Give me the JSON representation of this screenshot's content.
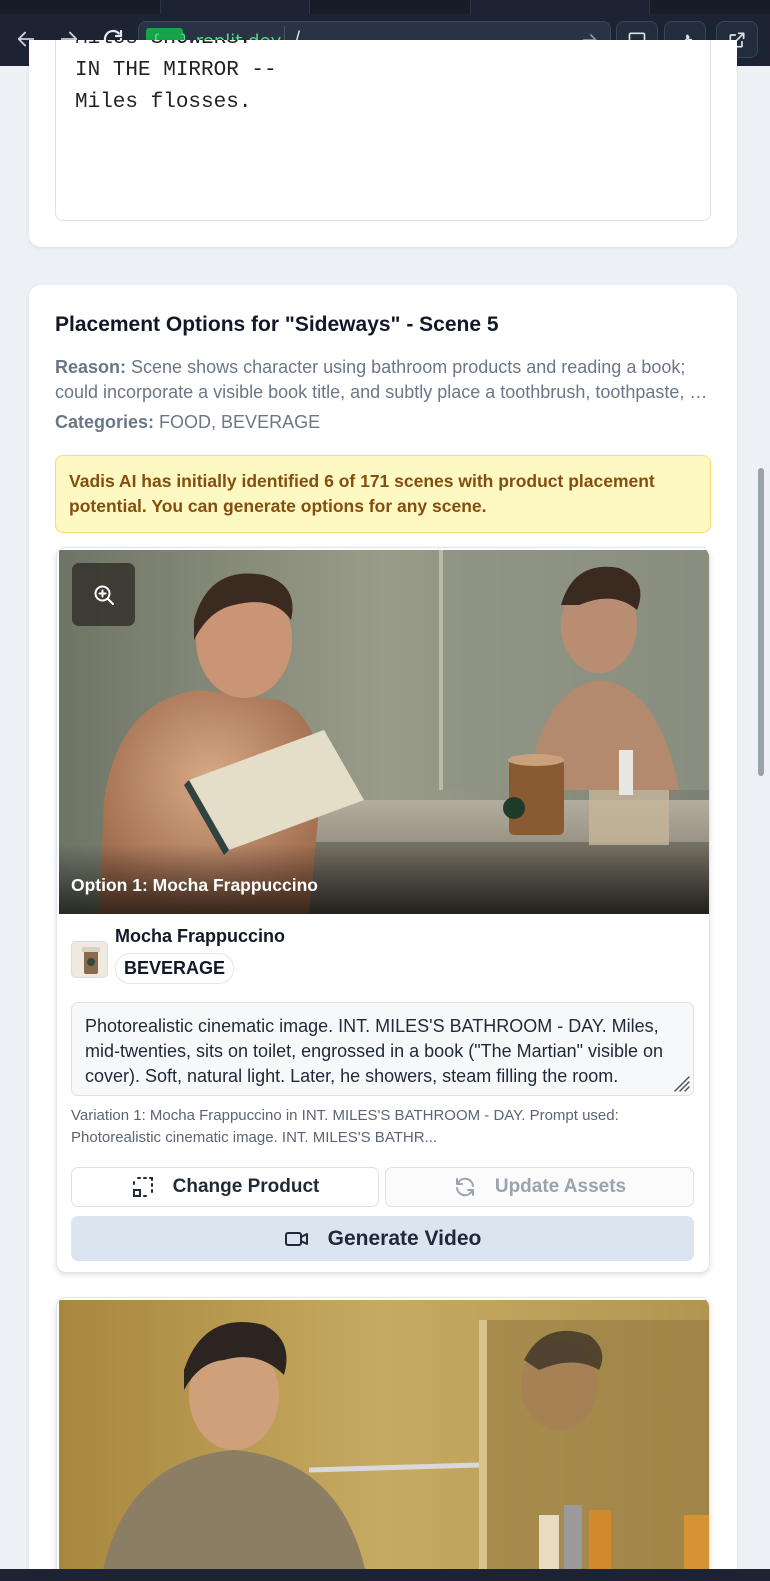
{
  "browser": {
    "host": "{...}.replit.dev",
    "path": "/"
  },
  "script_excerpt": "Miles SHOWERS.\nIN THE MIRROR --\nMiles flosses.",
  "placement": {
    "title": "Placement Options for \"Sideways\" - Scene 5",
    "reason_label": "Reason:",
    "reason_text": "Scene shows character using bathroom products and reading a book; could incorporate a visible book title, and subtly place a toothbrush, toothpaste, or similar.",
    "categories_label": "Categories:",
    "categories_value": "FOOD, BEVERAGE",
    "notice": "Vadis AI has initially identified 6 of 171 scenes with product placement potential. You can generate options for any scene."
  },
  "options": [
    {
      "caption": "Option 1: Mocha Frappuccino",
      "product_name": "Mocha Frappuccino",
      "product_category": "BEVERAGE",
      "prompt": "Photorealistic cinematic image. INT. MILES'S BATHROOM - DAY. Miles, mid-twenties, sits on toilet, engrossed in a book (\"The Martian\" visible on cover). Soft, natural light.  Later, he showers, steam filling the room.",
      "variation": "Variation 1: Mocha Frappuccino in INT. MILES'S BATHROOM - DAY. Prompt used: Photorealistic cinematic image. INT. MILES'S BATHR...",
      "buttons": {
        "change_product": "Change Product",
        "update_assets": "Update Assets",
        "generate_video": "Generate Video"
      }
    }
  ],
  "colors": {
    "accent_green": "#4ade80",
    "notice_bg": "#fef9c3",
    "notice_text": "#854d0e",
    "generate_bg": "#dbe5f0"
  }
}
